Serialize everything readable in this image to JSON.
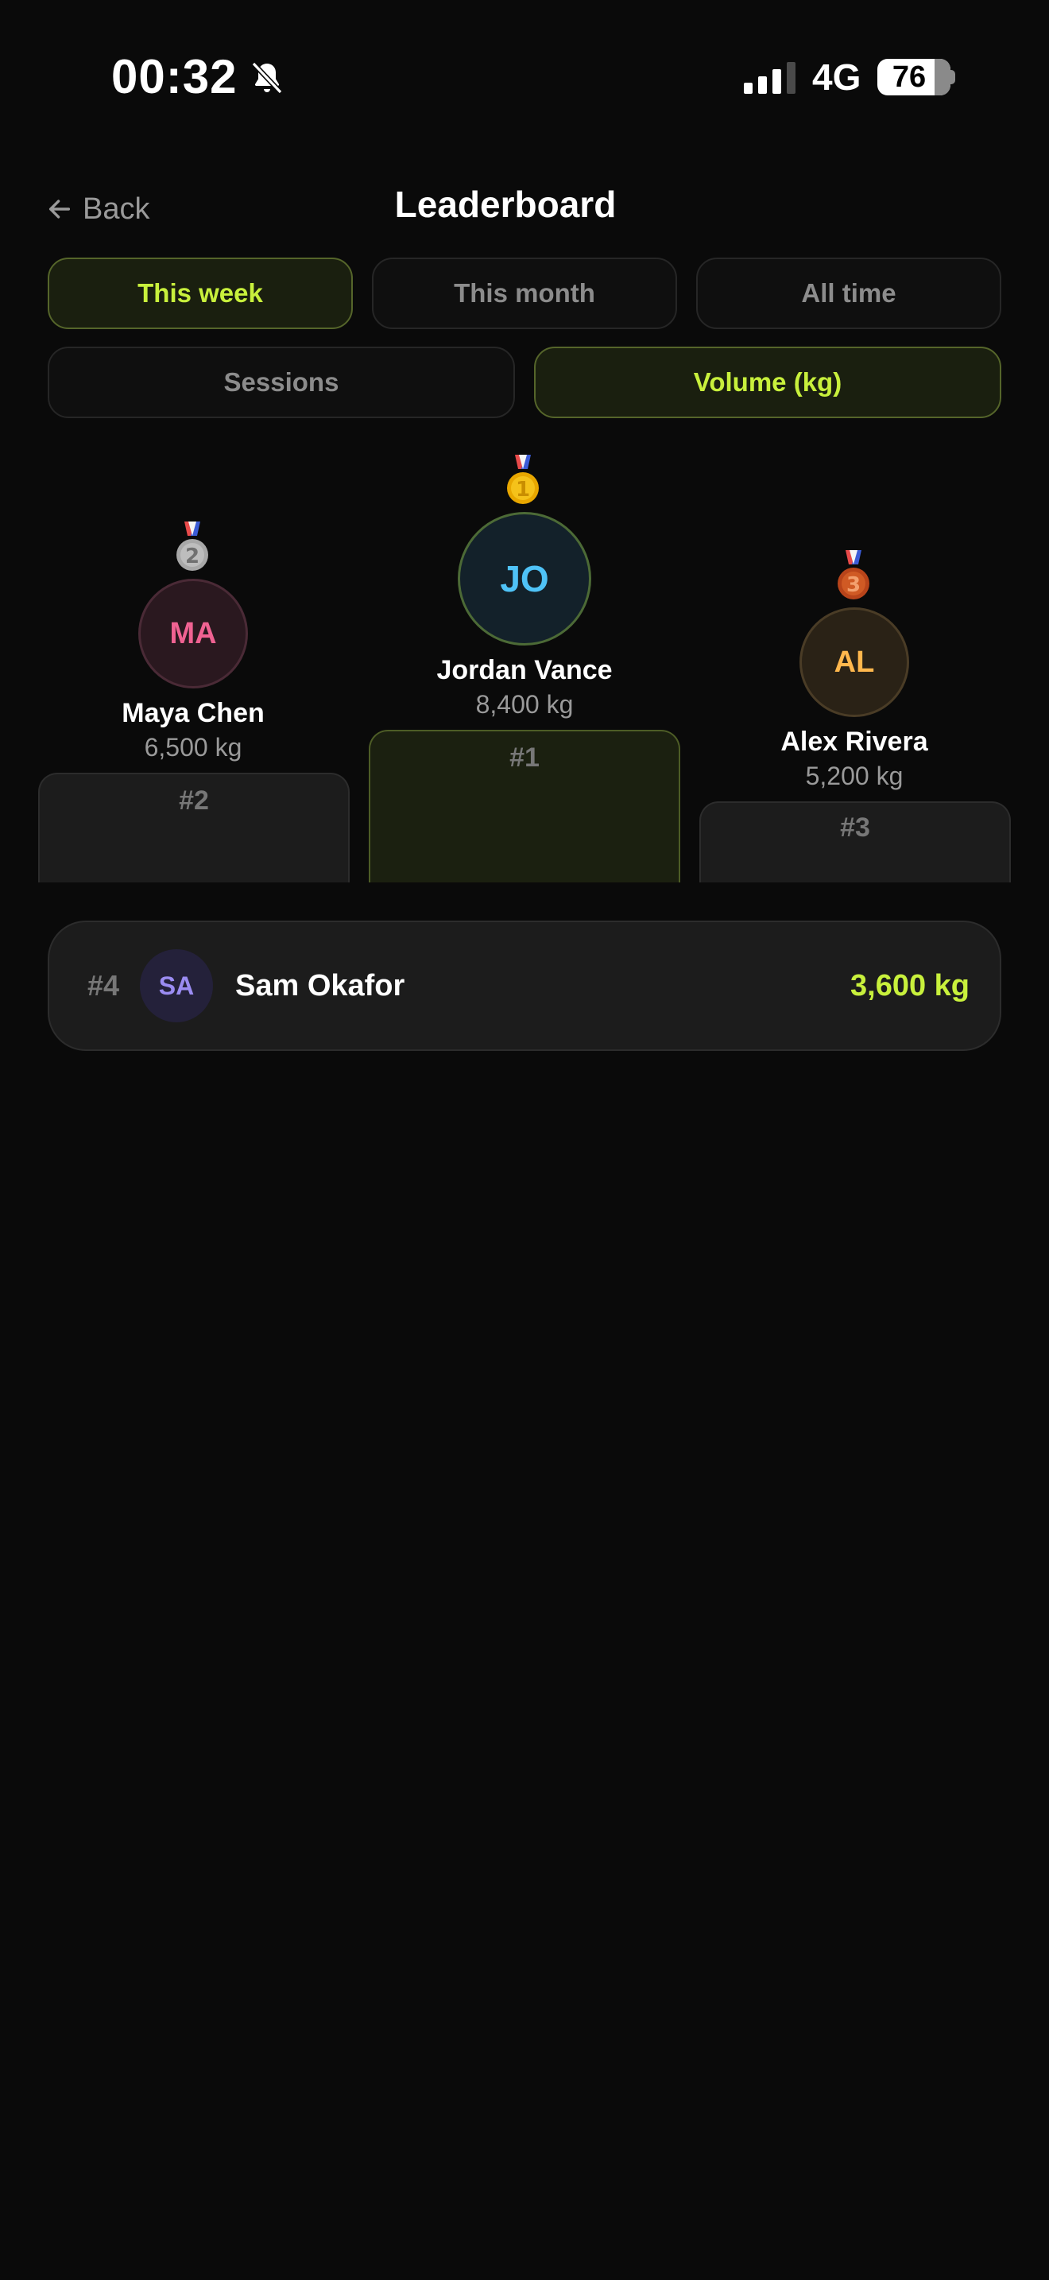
{
  "status": {
    "time": "00:32",
    "network": "4G",
    "battery": "76",
    "battery_level": 0.76
  },
  "header": {
    "back_label": "Back",
    "title": "Leaderboard"
  },
  "period_tabs": [
    {
      "label": "This week",
      "active": true
    },
    {
      "label": "This month",
      "active": false
    },
    {
      "label": "All time",
      "active": false
    }
  ],
  "metric_tabs": [
    {
      "label": "Sessions",
      "active": false
    },
    {
      "label": "Volume (kg)",
      "active": true
    }
  ],
  "podium": [
    {
      "rank": "#2",
      "medal": "2",
      "initials": "MA",
      "name": "Maya Chen",
      "value": "6,500 kg",
      "avatar_bg": "#2a181f",
      "avatar_border": "#4a2a36",
      "avatar_color": "#f06292"
    },
    {
      "rank": "#1",
      "medal": "1",
      "initials": "JO",
      "name": "Jordan Vance",
      "value": "8,400 kg",
      "avatar_bg": "#13212a",
      "avatar_border": "#4c6a36",
      "avatar_color": "#4fc3f7"
    },
    {
      "rank": "#3",
      "medal": "3",
      "initials": "AL",
      "name": "Alex Rivera",
      "value": "5,200 kg",
      "avatar_bg": "#2a2216",
      "avatar_border": "#4a3c26",
      "avatar_color": "#ffb74d"
    }
  ],
  "list": [
    {
      "rank": "#4",
      "initials": "SA",
      "name": "Sam Okafor",
      "value": "3,600 kg"
    }
  ],
  "colors": {
    "accent": "#c8f03c",
    "background": "#0a0a0a",
    "gold": "#f2b705",
    "silver": "#a8a8a8",
    "bronze": "#c0501e"
  }
}
